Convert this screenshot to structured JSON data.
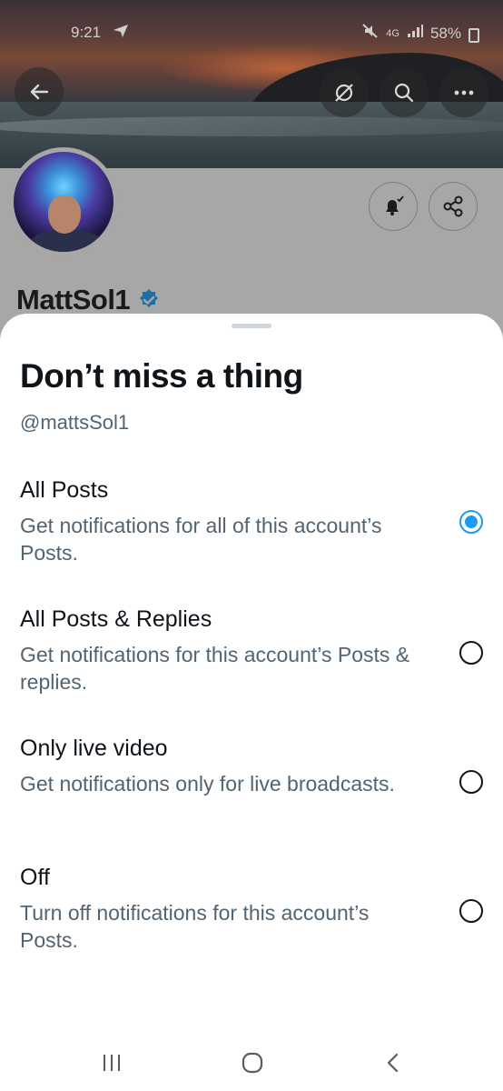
{
  "status_bar": {
    "time": "9:21",
    "battery": "58%",
    "network": "4G"
  },
  "profile": {
    "display_name": "MattSol1"
  },
  "sheet": {
    "title": "Don’t miss a thing",
    "handle": "@mattsSol1",
    "options": [
      {
        "title": "All Posts",
        "description": "Get notifications for all of this account’s Posts.",
        "selected": true
      },
      {
        "title": "All Posts & Replies",
        "description": "Get notifications for this account’s Posts & replies.",
        "selected": false
      },
      {
        "title": "Only live video",
        "description": "Get notifications only for live broadcasts.",
        "selected": false
      },
      {
        "title": "Off",
        "description": "Turn off notifications for this account’s Posts.",
        "selected": false
      }
    ]
  },
  "colors": {
    "accent": "#1d9bf0",
    "text_primary": "#0f1419",
    "text_secondary": "#536471"
  }
}
